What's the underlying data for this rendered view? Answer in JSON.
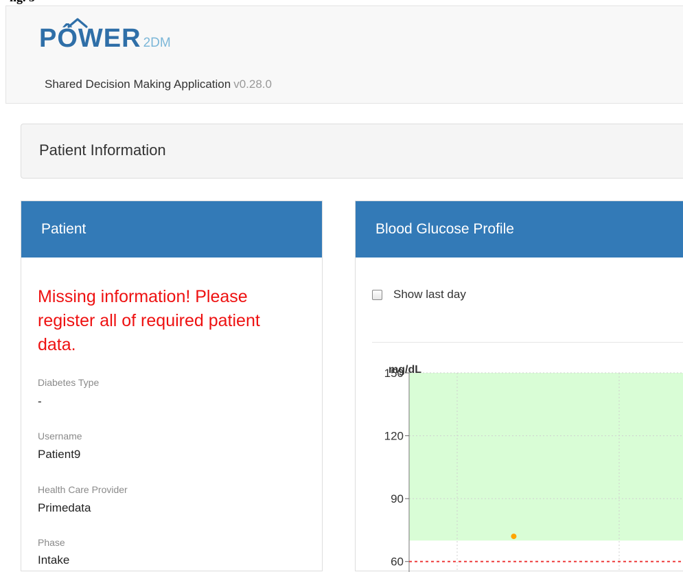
{
  "header": {
    "logo_text": "PÔWER",
    "logo_sub": "2DM",
    "app_name": "Shared Decision Making Application",
    "version": "v0.28.0"
  },
  "info_bar": {
    "title": "Patient Information"
  },
  "patient_panel": {
    "title": "Patient",
    "alert": "Missing information! Please register all of required patient data.",
    "fields": [
      {
        "label": "Diabetes Type",
        "value": "-"
      },
      {
        "label": "Username",
        "value": "Patient9"
      },
      {
        "label": "Health Care Provider",
        "value": "Primedata"
      },
      {
        "label": "Phase",
        "value": "Intake"
      }
    ]
  },
  "glucose_panel": {
    "title": "Blood Glucose Profile",
    "show_last_day_label": "Show last day",
    "show_last_day_checked": false
  },
  "colors": {
    "panel_header": "#337ab7",
    "alert": "#ee1111",
    "target_band": "#d9fdd6",
    "threshold_line": "#ee3b3b",
    "point": "#ffa500"
  },
  "chart_data": {
    "type": "scatter",
    "ylabel": "mg/dL",
    "ylim": [
      55,
      150
    ],
    "y_ticks": [
      60,
      90,
      120,
      150
    ],
    "target_range": [
      70,
      150
    ],
    "threshold_line": 60,
    "grid": true,
    "series": [
      {
        "values": [
          {
            "x": 0.37,
            "y": 72
          }
        ]
      }
    ]
  }
}
